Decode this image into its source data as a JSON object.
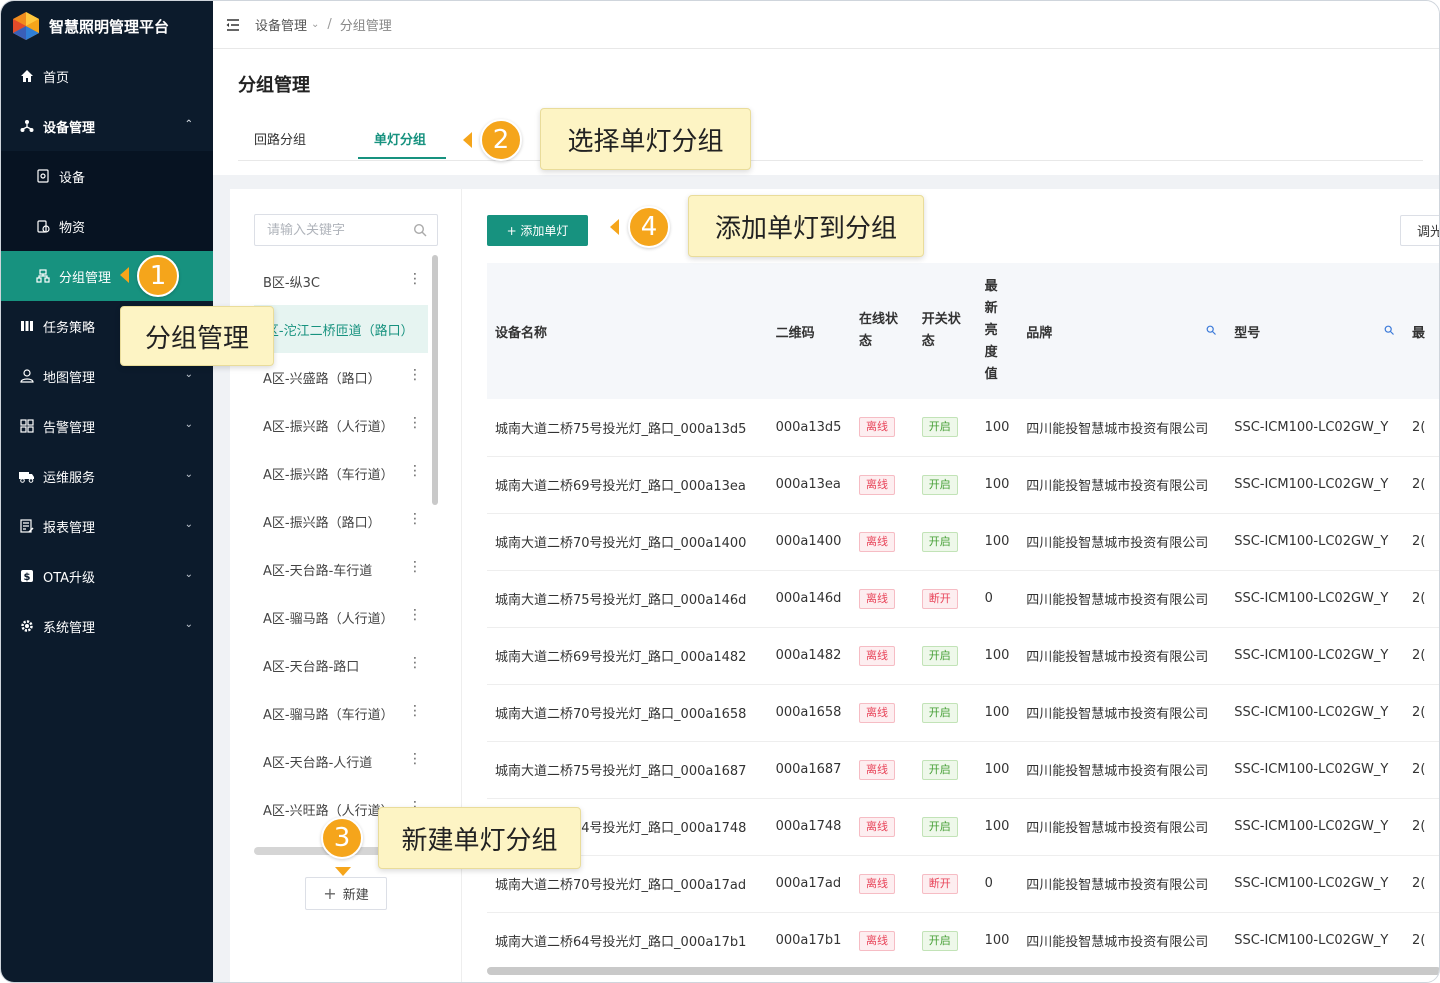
{
  "app": {
    "title": "智慧照明管理平台"
  },
  "colors": {
    "sidebar_bg": "#0c1b2c",
    "accent": "#17927f",
    "offline": "#e8465b",
    "on": "#48a038",
    "callout_bg": "#fdf4c4",
    "badge": "#f5a51b"
  },
  "sidebar": {
    "items": [
      {
        "label": "首页",
        "icon": "home-icon"
      },
      {
        "label": "设备管理",
        "icon": "device-tree-icon",
        "expanded": true
      },
      {
        "label": "设备",
        "icon": "device-icon"
      },
      {
        "label": "物资",
        "icon": "material-icon"
      },
      {
        "label": "分组管理",
        "icon": "group-icon",
        "active": true
      },
      {
        "label": "任务策略",
        "icon": "strategy-icon"
      },
      {
        "label": "地图管理",
        "icon": "map-user-icon"
      },
      {
        "label": "告警管理",
        "icon": "alarm-grid-icon"
      },
      {
        "label": "运维服务",
        "icon": "truck-icon"
      },
      {
        "label": "报表管理",
        "icon": "report-icon"
      },
      {
        "label": "OTA升级",
        "icon": "ota-icon"
      },
      {
        "label": "系统管理",
        "icon": "gear-icon"
      }
    ]
  },
  "breadcrumb": {
    "first": "设备管理",
    "sep": "/",
    "last": "分组管理"
  },
  "page": {
    "title": "分组管理"
  },
  "tabs": [
    {
      "label": "回路分组"
    },
    {
      "label": "单灯分组",
      "active": true
    }
  ],
  "search": {
    "placeholder": "请输入关键字"
  },
  "groups": [
    "B区-纵3C",
    "A区-沱江二桥匝道（路口）",
    "A区-兴盛路（路口）",
    "A区-振兴路（人行道）",
    "A区-振兴路（车行道）",
    "A区-振兴路（路口）",
    "A区-天台路-车行道",
    "A区-骝马路（人行道）",
    "A区-天台路-路口",
    "A区-骝马路（车行道）",
    "A区-天台路-人行道",
    "A区-兴旺路（人行道）"
  ],
  "buttons": {
    "new": "新建",
    "add_lamp": "+ 添加单灯",
    "adjust": "调光"
  },
  "table": {
    "headers": {
      "name": "设备名称",
      "qr": "二维码",
      "online": "在线状态",
      "switch": "开关状态",
      "brightness": "最新亮度值",
      "brand": "品牌",
      "model": "型号",
      "more": "最"
    },
    "rows": [
      {
        "name": "城南大道二桥75号投光灯_路口_000a13d5",
        "qr": "000a13d5",
        "online": "离线",
        "switch": "开启",
        "brightness": "100",
        "brand": "四川能投智慧城市投资有限公司",
        "model": "SSC-ICM100-LC02GW_Y",
        "more": "2("
      },
      {
        "name": "城南大道二桥69号投光灯_路口_000a13ea",
        "qr": "000a13ea",
        "online": "离线",
        "switch": "开启",
        "brightness": "100",
        "brand": "四川能投智慧城市投资有限公司",
        "model": "SSC-ICM100-LC02GW_Y",
        "more": "2("
      },
      {
        "name": "城南大道二桥70号投光灯_路口_000a1400",
        "qr": "000a1400",
        "online": "离线",
        "switch": "开启",
        "brightness": "100",
        "brand": "四川能投智慧城市投资有限公司",
        "model": "SSC-ICM100-LC02GW_Y",
        "more": "2("
      },
      {
        "name": "城南大道二桥75号投光灯_路口_000a146d",
        "qr": "000a146d",
        "online": "离线",
        "switch": "断开",
        "brightness": "0",
        "brand": "四川能投智慧城市投资有限公司",
        "model": "SSC-ICM100-LC02GW_Y",
        "more": "2("
      },
      {
        "name": "城南大道二桥69号投光灯_路口_000a1482",
        "qr": "000a1482",
        "online": "离线",
        "switch": "开启",
        "brightness": "100",
        "brand": "四川能投智慧城市投资有限公司",
        "model": "SSC-ICM100-LC02GW_Y",
        "more": "2("
      },
      {
        "name": "城南大道二桥70号投光灯_路口_000a1658",
        "qr": "000a1658",
        "online": "离线",
        "switch": "开启",
        "brightness": "100",
        "brand": "四川能投智慧城市投资有限公司",
        "model": "SSC-ICM100-LC02GW_Y",
        "more": "2("
      },
      {
        "name": "城南大道二桥75号投光灯_路口_000a1687",
        "qr": "000a1687",
        "online": "离线",
        "switch": "开启",
        "brightness": "100",
        "brand": "四川能投智慧城市投资有限公司",
        "model": "SSC-ICM100-LC02GW_Y",
        "more": "2("
      },
      {
        "name": "城南大道二桥64号投光灯_路口_000a1748",
        "qr": "000a1748",
        "online": "离线",
        "switch": "开启",
        "brightness": "100",
        "brand": "四川能投智慧城市投资有限公司",
        "model": "SSC-ICM100-LC02GW_Y",
        "more": "2("
      },
      {
        "name": "城南大道二桥70号投光灯_路口_000a17ad",
        "qr": "000a17ad",
        "online": "离线",
        "switch": "断开",
        "brightness": "0",
        "brand": "四川能投智慧城市投资有限公司",
        "model": "SSC-ICM100-LC02GW_Y",
        "more": "2("
      },
      {
        "name": "城南大道二桥64号投光灯_路口_000a17b1",
        "qr": "000a17b1",
        "online": "离线",
        "switch": "开启",
        "brightness": "100",
        "brand": "四川能投智慧城市投资有限公司",
        "model": "SSC-ICM100-LC02GW_Y",
        "more": "2("
      }
    ]
  },
  "annotations": [
    {
      "number": "1",
      "text": "分组管理"
    },
    {
      "number": "2",
      "text": "选择单灯分组"
    },
    {
      "number": "3",
      "text": "新建单灯分组"
    },
    {
      "number": "4",
      "text": "添加单灯到分组"
    }
  ]
}
